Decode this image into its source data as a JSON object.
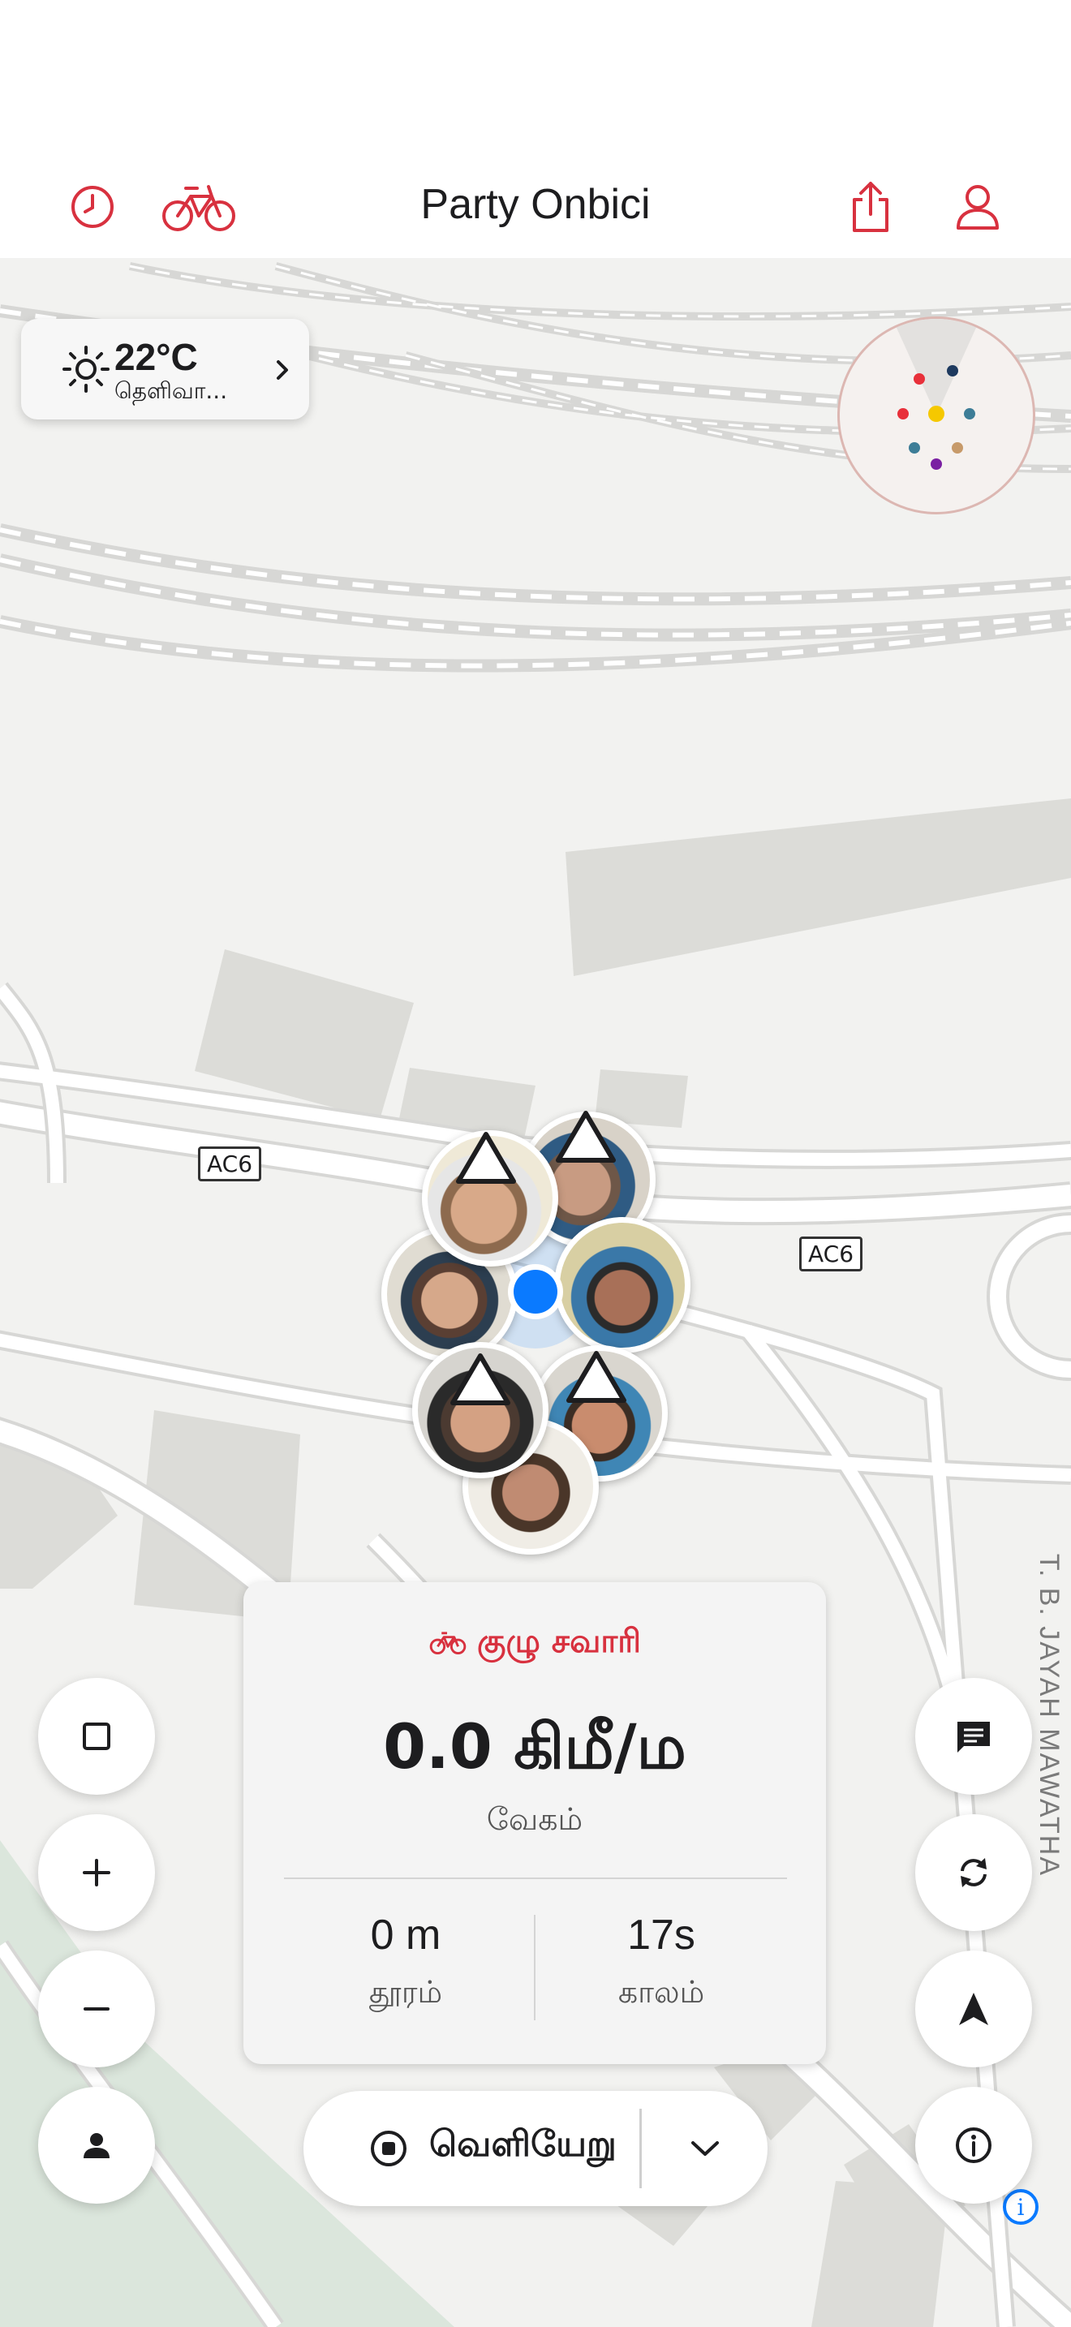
{
  "header": {
    "title": "Party Onbici",
    "icons": [
      "history-icon",
      "bicycle-icon",
      "share-icon",
      "profile-icon"
    ]
  },
  "weather": {
    "temperature": "22°C",
    "condition": "தெளிவா...",
    "icon": "sun-icon"
  },
  "map": {
    "road_labels": [
      "AC6",
      "AC6"
    ],
    "street_name": "T. B. JAYAH MAWATHA",
    "park_color": "#dbe6dc",
    "building_color": "#dcdcd8",
    "user_location_color": "#0a7aff"
  },
  "radar": {
    "dot_colors": [
      "#e8303a",
      "#1e3a5f",
      "#e8303a",
      "#f5c800",
      "#3d7d97",
      "#3d7d97",
      "#c79a6a",
      "#7a1fa2"
    ]
  },
  "ride_panel": {
    "mode_label": "குழு சவாரி",
    "speed_value": "0.0 கிமீ/ம",
    "speed_label": "வேகம்",
    "distance_value": "0 m",
    "distance_label": "தூரம்",
    "duration_value": "17s",
    "duration_label": "காலம்"
  },
  "exit_button": {
    "label": "வெளியேறு"
  },
  "left_controls": [
    "square-icon",
    "plus-icon",
    "minus-icon",
    "person-icon"
  ],
  "right_controls": [
    "chat-icon",
    "refresh-icon",
    "navigation-arrow-icon",
    "info-icon"
  ],
  "accent_color": "#d8313f"
}
